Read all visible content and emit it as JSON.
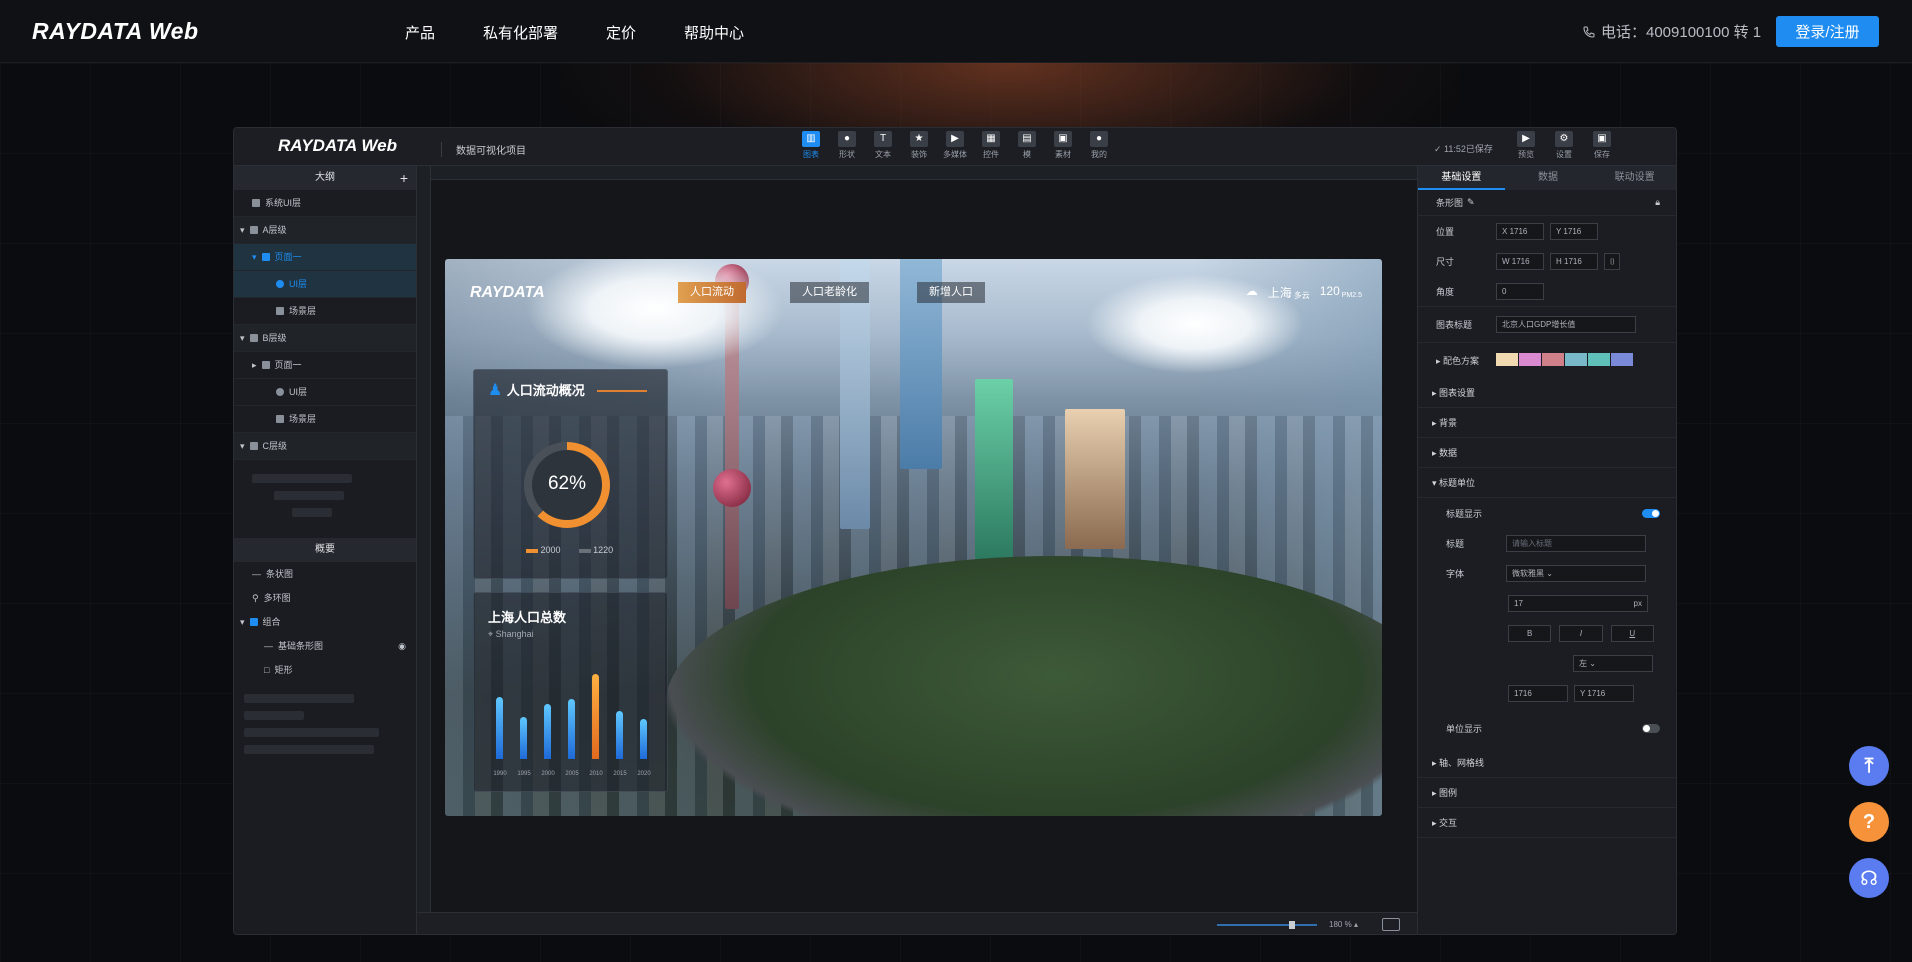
{
  "topnav": {
    "logo": "RAYDATA Web",
    "menu": [
      "产品",
      "私有化部署",
      "定价",
      "帮助中心"
    ],
    "phone": "电话：4009100100 转 1",
    "login": "登录/注册"
  },
  "editor": {
    "logo": "RAYDATA Web",
    "project": "数据可视化项目",
    "tools": [
      {
        "icon": "chart-icon",
        "label": "图表"
      },
      {
        "icon": "shape-icon",
        "label": "形状"
      },
      {
        "icon": "text-icon",
        "label": "文本"
      },
      {
        "icon": "star-icon",
        "label": "装饰"
      },
      {
        "icon": "media-icon",
        "label": "多媒体"
      },
      {
        "icon": "widget-icon",
        "label": "控件"
      },
      {
        "icon": "template-icon",
        "label": "模"
      },
      {
        "icon": "material-icon",
        "label": "素材"
      },
      {
        "icon": "mine-icon",
        "label": "我的"
      }
    ],
    "saved": "11:52已保存",
    "right_tools": [
      "预览",
      "设置",
      "保存"
    ]
  },
  "outline": {
    "title": "大纲",
    "items": [
      {
        "label": "系统UI层",
        "level": 1
      },
      {
        "label": "A层级",
        "level": 0
      },
      {
        "label": "页面一",
        "level": 1,
        "selected": true
      },
      {
        "label": "UI层",
        "level": 2,
        "selected": true
      },
      {
        "label": "场景层",
        "level": 2
      },
      {
        "label": "B层级",
        "level": 0
      },
      {
        "label": "页面一",
        "level": 1
      },
      {
        "label": "UI层",
        "level": 2
      },
      {
        "label": "场景层",
        "level": 2
      },
      {
        "label": "C层级",
        "level": 0
      }
    ],
    "overview_title": "概要",
    "overview_items": [
      "条状图",
      "多环图",
      "组合",
      "基础条形图",
      "矩形"
    ]
  },
  "scene": {
    "logo": "RAYDATA",
    "tabs": [
      "人口流动",
      "人口老龄化",
      "新增人口"
    ],
    "weather_city": "上海",
    "weather_sub": "多云",
    "aqi": "120",
    "aqi_label": "PM2.5",
    "card1_title": "人口流动概况",
    "gauge_value": "62%",
    "legend_a": "2000",
    "legend_b": "1220",
    "card2_title": "上海人口总数",
    "card2_sub": "Shanghai"
  },
  "chart_data": {
    "type": "bar",
    "categories": [
      "1990",
      "1995",
      "2000",
      "2005",
      "2010",
      "2015",
      "2020"
    ],
    "values": [
      0.62,
      0.42,
      0.55,
      0.6,
      0.85,
      0.48,
      0.4
    ],
    "highlight_index": 4,
    "title": "上海人口总数"
  },
  "props": {
    "tabs": [
      "基础设置",
      "数据",
      "联动设置"
    ],
    "component": "条形图",
    "position_label": "位置",
    "pos_x": "1716",
    "pos_y": "1716",
    "size_label": "尺寸",
    "size_w": "1716",
    "size_h": "1716",
    "angle_label": "角度",
    "angle": "0",
    "chart_title_label": "图表标题",
    "chart_title": "北京人口GDP增长值",
    "palette_label": "配色方案",
    "palette": [
      "#f0d8b0",
      "#d98ad0",
      "#d08088",
      "#78b8c8",
      "#5ec0b8",
      "#7a8ad8"
    ],
    "sections": [
      "图表设置",
      "背景",
      "数据",
      "标题单位"
    ],
    "title_display": "标题显示",
    "title_label": "标题",
    "title_placeholder": "请输入标题",
    "font_label": "字体",
    "font_value": "微软雅黑",
    "font_size": "17",
    "font_unit": "px",
    "align_value": "左",
    "offset_x": "1716",
    "offset_y": "1716",
    "unit_display": "单位显示",
    "sections2": [
      "轴、网格线",
      "图例",
      "交互"
    ]
  },
  "bottombar": {
    "zoom": "180",
    "zoom_unit": "%"
  }
}
